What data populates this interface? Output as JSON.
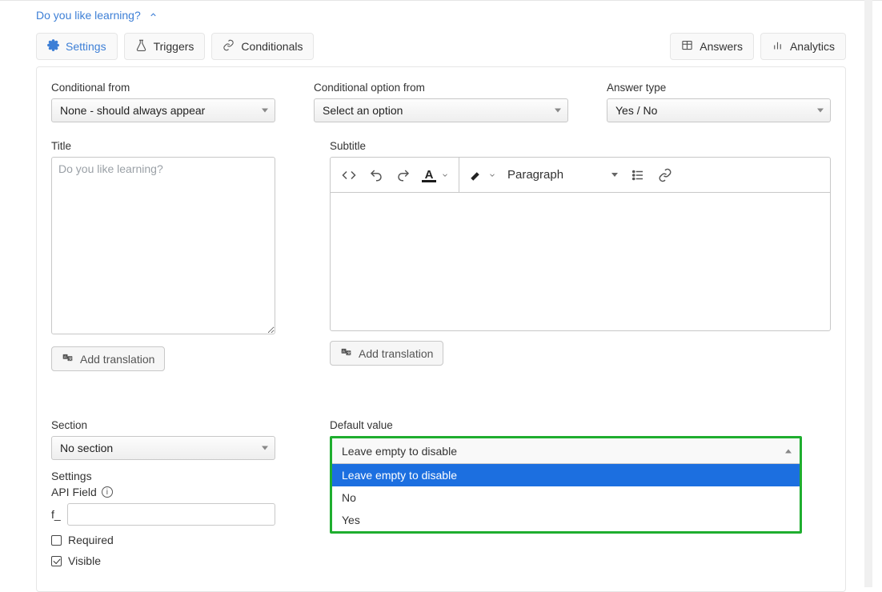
{
  "breadcrumb": {
    "title": "Do you like learning?"
  },
  "tabs": {
    "settings": "Settings",
    "triggers": "Triggers",
    "conditionals": "Conditionals",
    "answers": "Answers",
    "analytics": "Analytics"
  },
  "fields": {
    "conditional_from": {
      "label": "Conditional from",
      "value": "None - should always appear"
    },
    "conditional_option_from": {
      "label": "Conditional option from",
      "value": "Select an option"
    },
    "answer_type": {
      "label": "Answer type",
      "value": "Yes / No"
    },
    "title": {
      "label": "Title",
      "placeholder": "Do you like learning?"
    },
    "subtitle": {
      "label": "Subtitle"
    },
    "add_translation": "Add translation",
    "paragraph": "Paragraph",
    "section": {
      "label": "Section",
      "value": "No section"
    },
    "settings": {
      "label": "Settings"
    },
    "api_field": {
      "label": "API Field",
      "prefix": "f_"
    },
    "required": {
      "label": "Required",
      "checked": false
    },
    "visible": {
      "label": "Visible",
      "checked": true
    },
    "default_value": {
      "label": "Default value",
      "selected": "Leave empty to disable",
      "options": [
        "Leave empty to disable",
        "No",
        "Yes"
      ]
    }
  }
}
